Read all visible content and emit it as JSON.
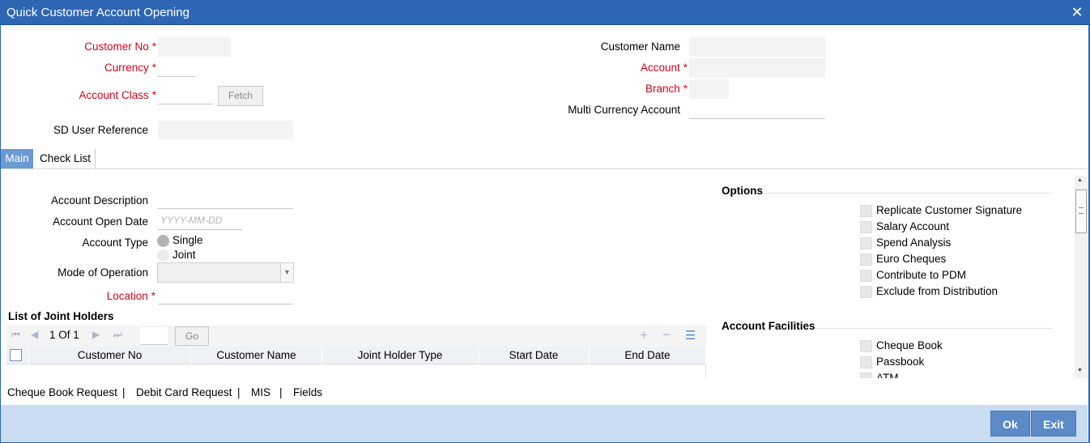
{
  "window": {
    "title": "Quick Customer Account Opening"
  },
  "header": {
    "customer_no_label": "Customer No",
    "currency_label": "Currency",
    "account_class_label": "Account Class",
    "fetch_label": "Fetch",
    "sd_user_reference_label": "SD User Reference",
    "customer_name_label": "Customer Name",
    "account_label": "Account",
    "branch_label": "Branch",
    "multi_currency_account_label": "Multi Currency Account",
    "required_mark": "*"
  },
  "tabs": [
    {
      "label": "Main",
      "active": true
    },
    {
      "label": "Check List",
      "active": false
    }
  ],
  "main": {
    "account_description_label": "Account Description",
    "account_open_date_label": "Account Open Date",
    "account_open_date_placeholder": "YYYY-MM-DD",
    "account_type_label": "Account Type",
    "account_type_options": [
      "Single",
      "Joint"
    ],
    "account_type_selected": "Single",
    "mode_of_operation_label": "Mode of Operation",
    "location_label": "Location"
  },
  "joint_holders": {
    "title": "List of Joint Holders",
    "pager_text": "1 Of 1",
    "go_label": "Go",
    "columns": [
      "Customer No",
      "Customer Name",
      "Joint Holder Type",
      "Start Date",
      "End Date"
    ],
    "rows": []
  },
  "options": {
    "title": "Options",
    "items": [
      {
        "label": "Replicate Customer Signature",
        "checked": false
      },
      {
        "label": "Salary Account",
        "checked": false
      },
      {
        "label": "Spend Analysis",
        "checked": false
      },
      {
        "label": "Euro Cheques",
        "checked": false
      },
      {
        "label": "Contribute to PDM",
        "checked": false
      },
      {
        "label": "Exclude from Distribution",
        "checked": false
      }
    ]
  },
  "facilities": {
    "title": "Account Facilities",
    "items": [
      {
        "label": "Cheque Book",
        "checked": false
      },
      {
        "label": "Passbook",
        "checked": false
      },
      {
        "label": "ATM",
        "checked": false
      }
    ]
  },
  "links": {
    "items": [
      "Cheque Book Request",
      "Debit Card Request",
      "MIS",
      "Fields"
    ],
    "separator": "|"
  },
  "footer": {
    "ok_label": "Ok",
    "exit_label": "Exit"
  },
  "colors": {
    "titlebar": "#2d67b3",
    "required": "#d9001a",
    "tab_active": "#6a9ad4",
    "footer": "#c9dcf1",
    "button": "#5b8ac6"
  }
}
